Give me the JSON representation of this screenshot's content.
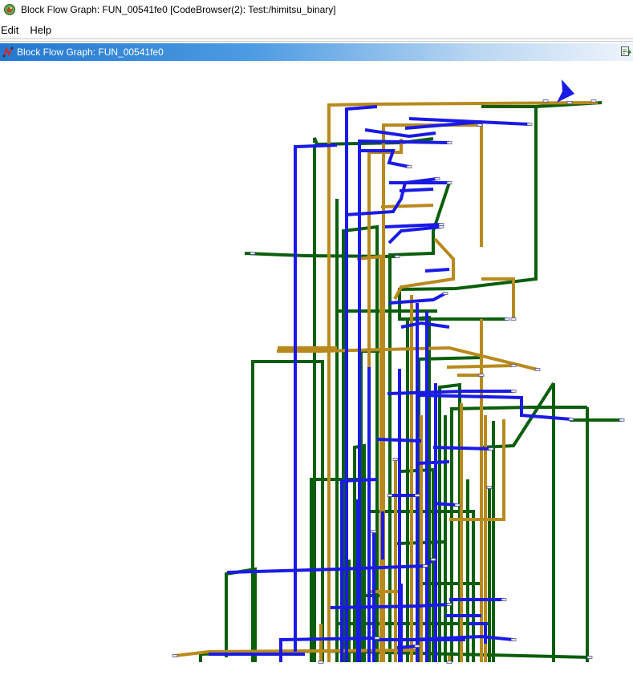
{
  "window": {
    "title": "Block Flow Graph: FUN_00541fe0 [CodeBrowser(2): Test:/himitsu_binary]",
    "icon": "ghidra-dragon-icon"
  },
  "menu": {
    "items": [
      "Edit",
      "Help"
    ]
  },
  "panel": {
    "title": "Block Flow Graph: FUN_00541fe0",
    "icon": "flow-graph-icon",
    "action_icon": "export-graph-icon"
  },
  "graph": {
    "edge_colors": {
      "fallthrough": "#0b5e0b",
      "unconditional": "#1a1ae6",
      "conditional": "#b88a1e"
    },
    "entry_marker_color": "#1a1ae6"
  }
}
